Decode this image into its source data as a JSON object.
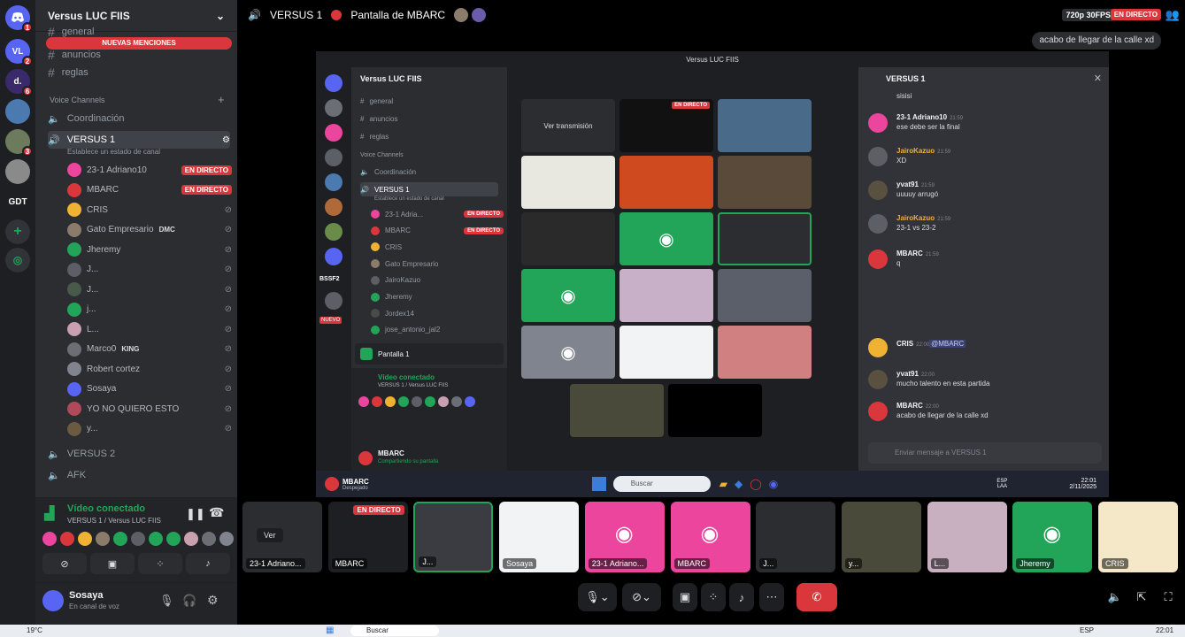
{
  "rail": {
    "items": [
      {
        "label": "",
        "badge": "1"
      },
      {
        "label": "VL",
        "badge": "2"
      },
      {
        "label": "d.",
        "badge": "6"
      },
      {
        "label": "",
        "badge": ""
      },
      {
        "label": "",
        "badge": "3"
      },
      {
        "label": "",
        "badge": ""
      },
      {
        "label": "GDT",
        "badge": ""
      }
    ]
  },
  "sidebar": {
    "server_name": "Versus LUC FIIS",
    "mentions_banner": "NUEVAS MENCIONES",
    "text_channels": [
      "general",
      "anuncios",
      "reglas"
    ],
    "voice_section": "Voice Channels",
    "voice_channels": {
      "coordinacion": "Coordinación",
      "versus1": "VERSUS 1",
      "versus1_status": "Establece un estado de canal",
      "versus2": "VERSUS 2",
      "afk": "AFK"
    },
    "voice_users": [
      {
        "name": "23-1 Adriano10",
        "live": "EN DIRECTO",
        "color": "#eb459e"
      },
      {
        "name": "MBARC",
        "live": "EN DIRECTO",
        "color": "#da373c"
      },
      {
        "name": "CRIS",
        "live": "",
        "color": "#f0b232"
      },
      {
        "name": "Gato Empresario",
        "tag": "DMC",
        "live": "",
        "color": "#8b7b6b"
      },
      {
        "name": "Jheremy",
        "live": "",
        "color": "#23a559"
      },
      {
        "name": "J...",
        "live": "",
        "color": "#5c5f66"
      },
      {
        "name": "J...",
        "live": "",
        "color": "#4a5a4a"
      },
      {
        "name": "j...",
        "live": "",
        "color": "#23a559"
      },
      {
        "name": "L...",
        "live": "",
        "color": "#c9a0b0"
      },
      {
        "name": "Marco0",
        "tag": "KING",
        "live": "",
        "color": "#6b6e75"
      },
      {
        "name": "Robert cortez",
        "live": "",
        "color": "#80848e"
      },
      {
        "name": "Sosaya",
        "live": "",
        "color": "#5865f2"
      },
      {
        "name": "YO NO QUIERO ESTO",
        "live": "",
        "color": "#b04a5a"
      },
      {
        "name": "y...",
        "live": "",
        "color": "#6a5a40"
      }
    ]
  },
  "voice_panel": {
    "status": "Vídeo conectado",
    "channel": "VERSUS 1 / Versus LUC FIIS"
  },
  "user_panel": {
    "name": "Sosaya",
    "status": "En canal de voz"
  },
  "topbar": {
    "channel": "VERSUS 1",
    "screen_label": "Pantalla de MBARC",
    "quality": "720p 30FPS",
    "live": "EN DIRECTO",
    "toast": "acabo de llegar de la calle xd"
  },
  "share": {
    "window_title": "Versus LUC FIIS",
    "inner_server": "Versus LUC FIIS",
    "inner_channels": [
      "general",
      "anuncios",
      "reglas"
    ],
    "inner_voice_section": "Voice Channels",
    "inner_coordinacion": "Coordinación",
    "inner_versus1": "VERSUS 1",
    "inner_status": "Establece un estado de canal",
    "inner_users": [
      "23-1 Adria...",
      "MBARC",
      "CRIS",
      "Gato Empresario",
      "JairoKazuo",
      "Jheremy",
      "Jordex14",
      "jose_antonio_jal2"
    ],
    "inner_live": "EN DIRECTO",
    "pantalla": "Pantalla 1",
    "inner_voice": "Vídeo conectado",
    "inner_voice_channel": "VERSUS 1 / Versus LUC FIIS",
    "inner_user": "MBARC",
    "inner_user_status": "Compartiendo su pantalla",
    "ver_transmision": "Ver transmisión",
    "tile_live": "EN DIRECTO",
    "rail_labels": [
      "BSSF2",
      "NUEVO"
    ],
    "chat_channel": "VERSUS 1",
    "chat_placeholder": "Enviar mensaje a  VERSUS 1",
    "taskbar_user": "MBARC",
    "taskbar_user_status": "Despejado",
    "taskbar_search": "Buscar",
    "taskbar_lang": "ESP",
    "taskbar_lang2": "LAA",
    "taskbar_time": "22:01",
    "taskbar_date": "2/11/2025",
    "messages": [
      {
        "author": "",
        "time": "",
        "text": "sisisi",
        "color": ""
      },
      {
        "author": "23-1 Adriano10",
        "time": "21:59",
        "text": "ese debe ser la final",
        "color": "#eb459e"
      },
      {
        "author": "JairoKazuo",
        "time": "21:59",
        "text": "XD",
        "color": "#5c5f66"
      },
      {
        "author": "yvat91",
        "time": "21:59",
        "text": "uuuuy arrugó",
        "color": "#5a5040"
      },
      {
        "author": "JairoKazuo",
        "time": "21:59",
        "text": "23-1 vs 23-2",
        "color": "#5c5f66"
      },
      {
        "author": "MBARC",
        "time": "21:59",
        "text": "q",
        "color": "#da373c"
      },
      {
        "author": "CRIS",
        "time": "22:00",
        "text": "@MBARC",
        "color": "#f0b232"
      },
      {
        "author": "yvat91",
        "time": "22:00",
        "text": "mucho talento en esta partida",
        "color": "#5a5040"
      },
      {
        "author": "MBARC",
        "time": "22:00",
        "text": "acabo de llegar de la calle xd",
        "color": "#da373c"
      }
    ]
  },
  "strip": {
    "ver": "Ver",
    "live": "EN DIRECTO",
    "tiles": [
      {
        "label": "23-1 Adriano...",
        "color": "#2b2d31"
      },
      {
        "label": "MBARC",
        "color": "#1e1f22"
      },
      {
        "label": "J...",
        "color": "#3a3c42"
      },
      {
        "label": "Sosaya",
        "color": "#f2f3f5"
      },
      {
        "label": "23-1 Adriano...",
        "color": "#eb459e"
      },
      {
        "label": "MBARC",
        "color": "#eb459e"
      },
      {
        "label": "J...",
        "color": "#2b2d31"
      },
      {
        "label": "y...",
        "color": "#4a4a3a"
      },
      {
        "label": "L...",
        "color": "#c9b0c0"
      },
      {
        "label": "Jheremy",
        "color": "#23a559"
      },
      {
        "label": "CRIS",
        "color": "#f5e8c8"
      }
    ]
  },
  "os_taskbar": {
    "weather": "19°C",
    "search": "Buscar",
    "lang": "ESP",
    "time": "22:01"
  }
}
